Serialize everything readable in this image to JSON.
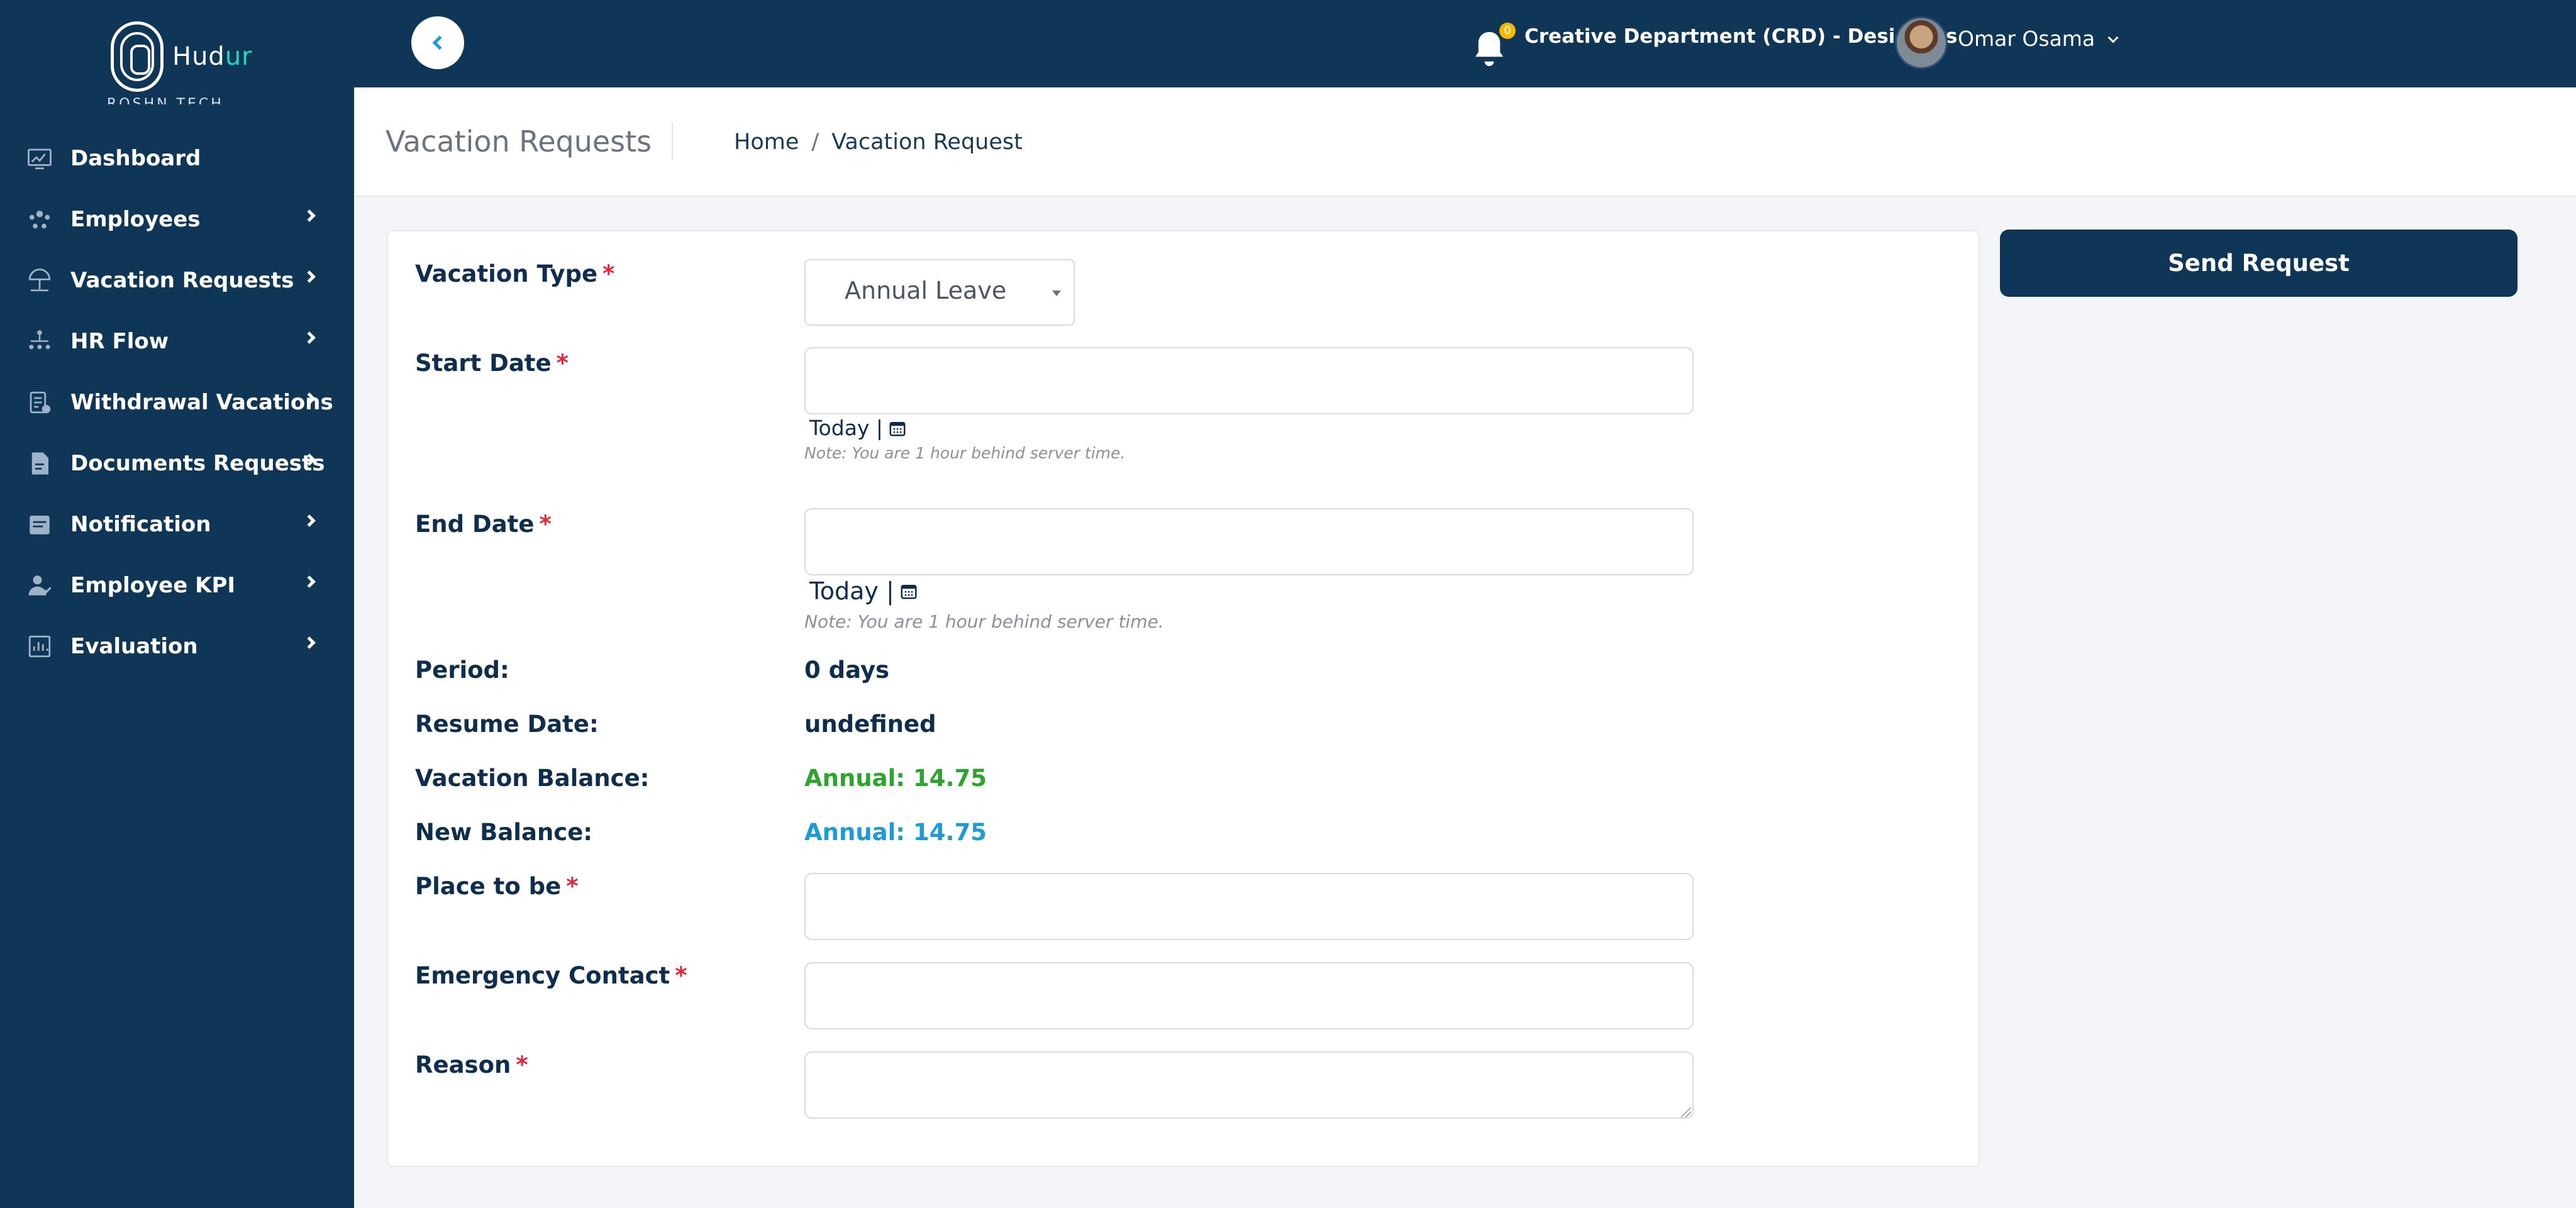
{
  "app": {
    "logo_text_main": "Hud",
    "logo_text_accent": "ur",
    "logo_subtitle": "ROSHN TECH",
    "accent_color": "#27d3c1",
    "brand_color": "#0f3557"
  },
  "sidebar": {
    "items": [
      {
        "label": "Dashboard",
        "icon": "dashboard-icon"
      },
      {
        "label": "Employees",
        "icon": "employees-icon"
      },
      {
        "label": "Vacation Requests",
        "icon": "beach-umbrella-icon"
      },
      {
        "label": "HR Flow",
        "icon": "hierarchy-icon"
      },
      {
        "label": "Withdrawal Vacations",
        "icon": "withdrawal-icon"
      },
      {
        "label": "Documents Requests",
        "icon": "document-icon"
      },
      {
        "label": "Notification",
        "icon": "notification-icon"
      },
      {
        "label": "Employee KPI",
        "icon": "kpi-icon"
      },
      {
        "label": "Evaluation",
        "icon": "evaluation-icon"
      }
    ]
  },
  "topbar": {
    "notification_count": "0",
    "department": "Creative Department (CRD) - Designers",
    "user_name": "Omar Osama"
  },
  "header": {
    "title": "Vacation Requests",
    "breadcrumb": [
      "Home",
      "/",
      "Vacation Request"
    ]
  },
  "form": {
    "vacation_type_label": "Vacation Type",
    "vacation_type_value": "Annual Leave",
    "start_date_label": "Start Date",
    "start_date_value": "",
    "end_date_label": "End Date",
    "end_date_value": "",
    "today_label": "Today |",
    "server_note": "Note: You are 1 hour behind server time.",
    "period_label": "Period:",
    "period_value": "0 days",
    "resume_date_label": "Resume Date:",
    "resume_date_value": "undefined",
    "vacation_balance_label": "Vacation Balance:",
    "vacation_balance_value": "Annual: 14.75",
    "new_balance_label": "New Balance:",
    "new_balance_value": "Annual: 14.75",
    "place_label": "Place to be",
    "place_value": "",
    "emergency_label": "Emergency Contact",
    "emergency_value": "",
    "reason_label": "Reason",
    "reason_value": "",
    "required_marker": "*"
  },
  "actions": {
    "send_label": "Send Request"
  }
}
